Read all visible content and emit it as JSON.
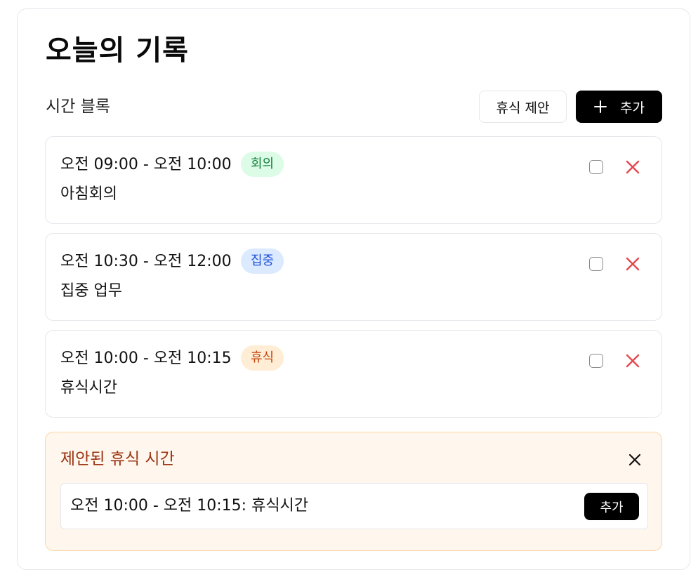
{
  "page": {
    "title": "오늘의 기록",
    "section_label": "시간 블록"
  },
  "toolbar": {
    "suggest_break_label": "휴식 제안",
    "add_label": "추가",
    "add_icon": "plus-icon"
  },
  "blocks": [
    {
      "time": "오전 09:00 - 오전 10:00",
      "tag": "회의",
      "tag_type": "meeting",
      "name": "아침회의",
      "checked": false
    },
    {
      "time": "오전 10:30 - 오전 12:00",
      "tag": "집중",
      "tag_type": "focus",
      "name": "집중 업무",
      "checked": false
    },
    {
      "time": "오전 10:00 - 오전 10:15",
      "tag": "휴식",
      "tag_type": "break",
      "name": "휴식시간",
      "checked": false
    }
  ],
  "suggestions": {
    "title": "제안된 휴식 시간",
    "close_icon": "close-icon",
    "items": [
      {
        "text": "오전 10:00 - 오전 10:15: 휴식시간",
        "add_label": "추가"
      }
    ]
  },
  "colors": {
    "primary": "#000000",
    "delete_icon": "#e5484d",
    "meeting_badge_bg": "#dcfce7",
    "focus_badge_bg": "#dbeafe",
    "break_badge_bg": "#ffedd5",
    "suggest_bg": "#fff7ed",
    "suggest_title": "#9a3412"
  }
}
